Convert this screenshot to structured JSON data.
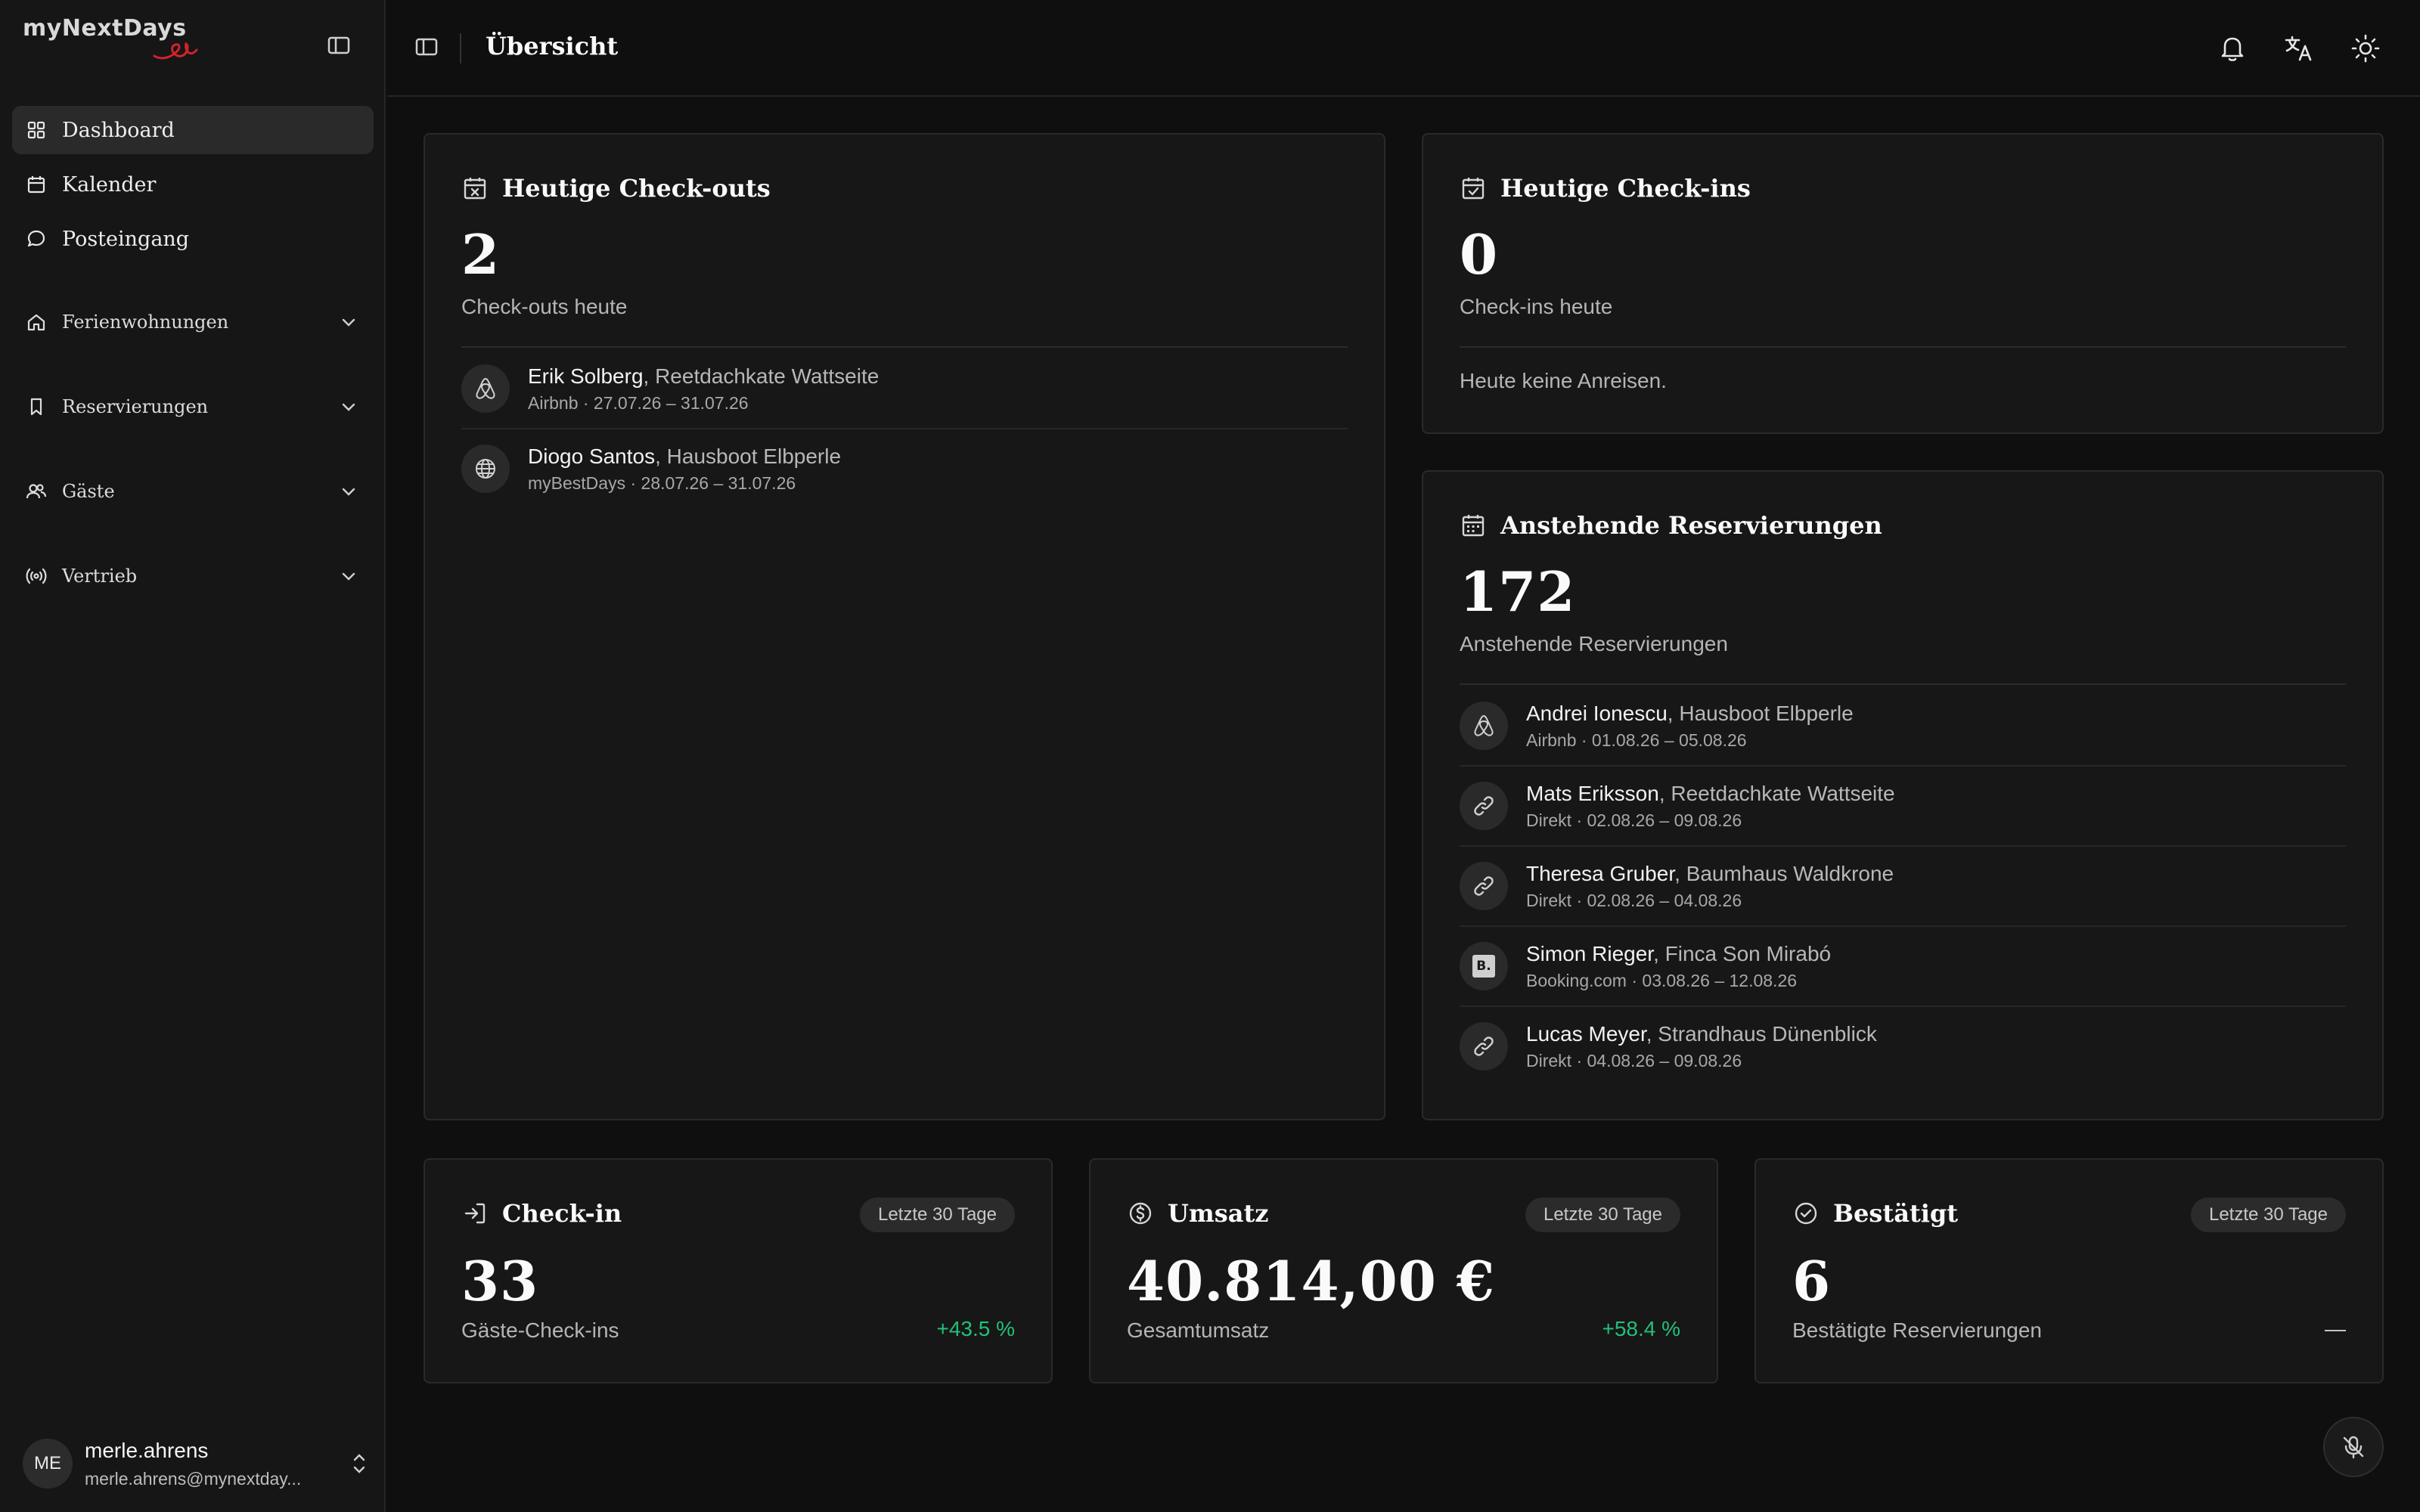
{
  "app": {
    "logo_text": "myNextDays",
    "page_title": "Übersicht"
  },
  "sidebar": {
    "nav": [
      {
        "label": "Dashboard",
        "icon": "grid-icon",
        "active": true
      },
      {
        "label": "Kalender",
        "icon": "calendar-icon",
        "active": false
      },
      {
        "label": "Posteingang",
        "icon": "message-icon",
        "active": false
      }
    ],
    "groups": [
      {
        "label": "Ferienwohnungen",
        "icon": "home-icon"
      },
      {
        "label": "Reservierungen",
        "icon": "bookmark-icon"
      },
      {
        "label": "Gäste",
        "icon": "users-icon"
      },
      {
        "label": "Vertrieb",
        "icon": "broadcast-icon"
      }
    ],
    "user": {
      "initials": "ME",
      "name": "merle.ahrens",
      "email": "merle.ahrens@mynextday..."
    }
  },
  "checkouts": {
    "title": "Heutige Check-outs",
    "count": "2",
    "subtitle": "Check-outs heute",
    "rows": [
      {
        "guest": "Erik Solberg",
        "property": ", Reetdachkate Wattseite",
        "details": "Airbnb · 27.07.26 – 31.07.26",
        "source_icon": "airbnb-icon"
      },
      {
        "guest": "Diogo Santos",
        "property": ", Hausboot Elbperle",
        "details": "myBestDays · 28.07.26 – 31.07.26",
        "source_icon": "globe-icon"
      }
    ]
  },
  "checkins": {
    "title": "Heutige Check-ins",
    "count": "0",
    "subtitle": "Check-ins heute",
    "empty": "Heute keine Anreisen."
  },
  "upcoming": {
    "title": "Anstehende Reservierungen",
    "count": "172",
    "subtitle": "Anstehende Reservierungen",
    "rows": [
      {
        "guest": "Andrei Ionescu",
        "property": ", Hausboot Elbperle",
        "details": "Airbnb · 01.08.26 – 05.08.26",
        "source_icon": "airbnb-icon"
      },
      {
        "guest": "Mats Eriksson",
        "property": ", Reetdachkate Wattseite",
        "details": "Direkt · 02.08.26 – 09.08.26",
        "source_icon": "link-icon"
      },
      {
        "guest": "Theresa Gruber",
        "property": ", Baumhaus Waldkrone",
        "details": "Direkt · 02.08.26 – 04.08.26",
        "source_icon": "link-icon"
      },
      {
        "guest": "Simon Rieger",
        "property": ", Finca Son Mirabó",
        "details": "Booking.com · 03.08.26 – 12.08.26",
        "source_icon": "booking-icon",
        "source_text": "B."
      },
      {
        "guest": "Lucas Meyer",
        "property": ", Strandhaus Dünenblick",
        "details": "Direkt · 04.08.26 – 09.08.26",
        "source_icon": "link-icon"
      }
    ]
  },
  "stats": [
    {
      "title": "Check-in",
      "icon": "login-icon",
      "period": "Letzte 30 Tage",
      "value": "33",
      "label": "Gäste-Check-ins",
      "trend": "+43.5 %"
    },
    {
      "title": "Umsatz",
      "icon": "dollar-circle-icon",
      "period": "Letzte 30 Tage",
      "value": "40.814,00 €",
      "label": "Gesamtumsatz",
      "trend": "+58.4 %"
    },
    {
      "title": "Bestätigt",
      "icon": "check-circle-icon",
      "period": "Letzte 30 Tage",
      "value": "6",
      "label": "Bestätigte Reservierungen",
      "trend": "—"
    }
  ],
  "colors": {
    "accent_positive": "#22c07a",
    "background": "#0f0f0f",
    "card": "#171717",
    "logo_red": "#d2232a"
  }
}
